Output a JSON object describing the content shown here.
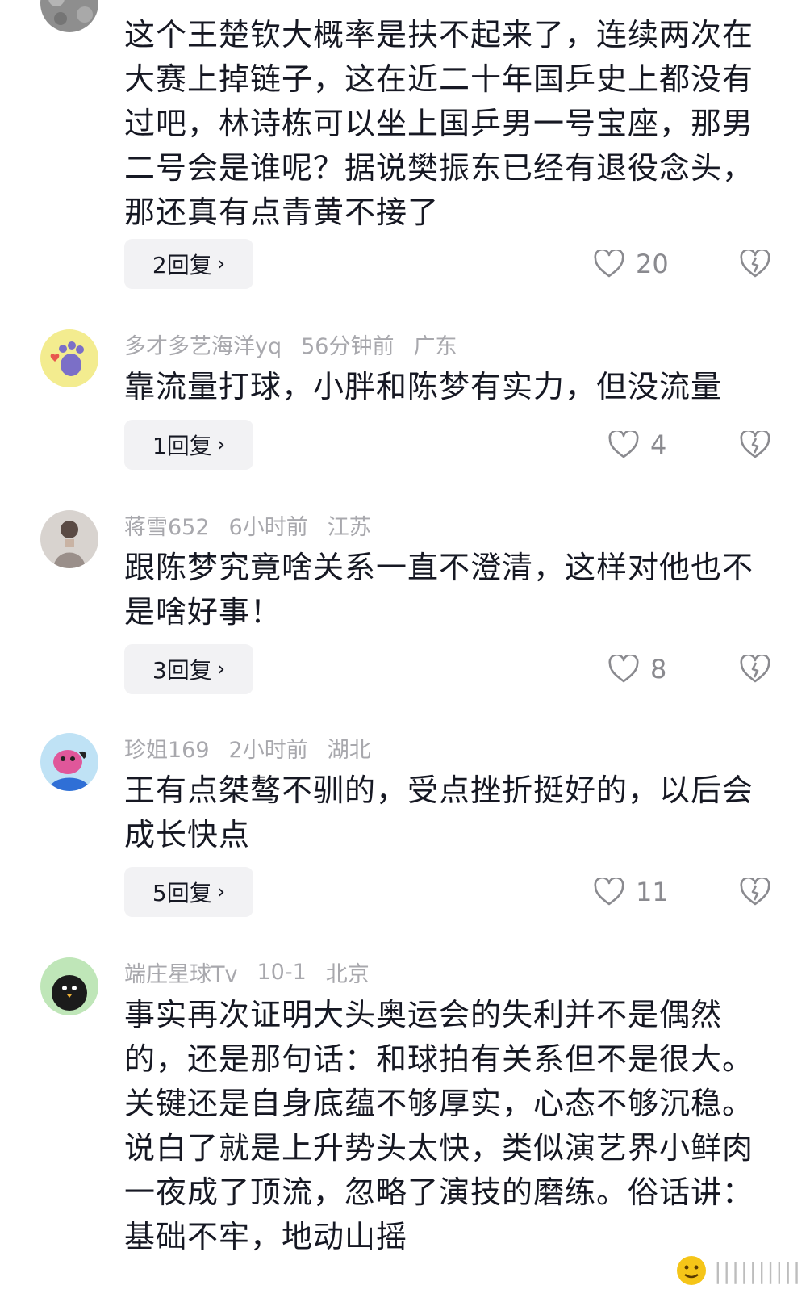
{
  "comments": [
    {
      "text": "这个王楚钦大概率是扶不起来了，连续两次在大赛上掉链子，这在近二十年国乒史上都没有过吧，林诗栋可以坐上国乒男一号宝座，那男二号会是谁呢？据说樊振东已经有退役念头，那还真有点青黄不接了",
      "replies": "2回复",
      "likes": "20",
      "avatar_icon": "grey-texture-avatar"
    },
    {
      "username": "多才多艺海洋yq",
      "time": "56分钟前",
      "location": "广东",
      "text": "靠流量打球，小胖和陈梦有实力，但没流量",
      "replies": "1回复",
      "likes": "4",
      "avatar_icon": "cat-paw-avatar"
    },
    {
      "username": "蒋雪652",
      "time": "6小时前",
      "location": "江苏",
      "text": "跟陈梦究竟啥关系一直不澄清，这样对他也不是啥好事！",
      "replies": "3回复",
      "likes": "8",
      "avatar_icon": "person-photo-avatar"
    },
    {
      "username": "珍姐169",
      "time": "2小时前",
      "location": "湖北",
      "text": "王有点桀骜不驯的，受点挫折挺好的，以后会成长快点",
      "replies": "5回复",
      "likes": "11",
      "avatar_icon": "cartoon-character-avatar"
    },
    {
      "username": "端庄星球Tv",
      "time": "10-1",
      "location": "北京",
      "text": "事实再次证明大头奥运会的失利并不是偶然的，还是那句话：和球拍有关系但不是很大。关键还是自身底蕴不够厚实，心态不够沉稳。说白了就是上升势头太快，类似演艺界小鲜肉一夜成了顶流，忽略了演技的磨练。俗话讲：基础不牢，地动山摇",
      "avatar_icon": "black-bird-avatar"
    }
  ],
  "icons": {
    "like": "heart-outline-icon",
    "dislike": "broken-heart-icon",
    "reply_chevron": "chevron-right-icon",
    "watermark": "emoji-watermark-icon"
  },
  "colors": {
    "meta_text": "#a8a8ad",
    "body_text": "#161823",
    "reply_bg": "#f2f2f4",
    "icon_gray": "#8a8a8f"
  }
}
